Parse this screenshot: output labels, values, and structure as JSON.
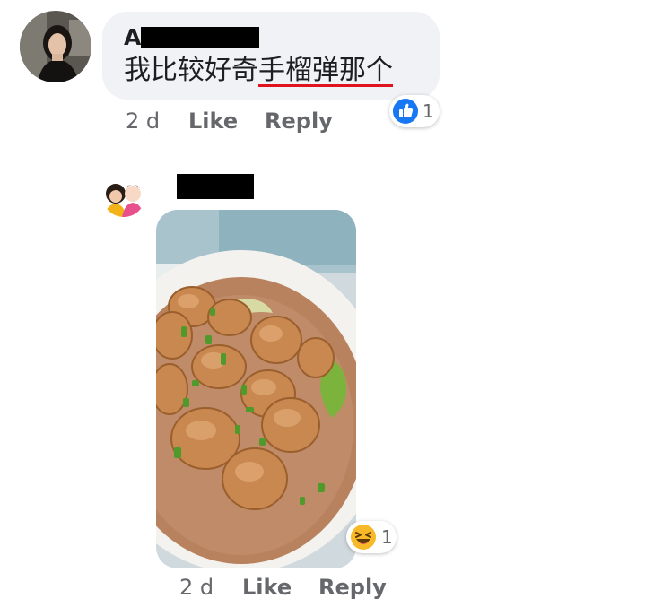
{
  "comment": {
    "author_initial": "A",
    "text_plain": "我比较好奇",
    "text_underlined": "手榴弹那个",
    "time": "2 d",
    "like_label": "Like",
    "reply_label": "Reply",
    "reaction": {
      "icon": "thumbs-up-icon",
      "color": "#1877f2",
      "count": "1"
    }
  },
  "reply": {
    "time": "2 d",
    "like_label": "Like",
    "reply_label": "Reply",
    "reaction": {
      "icon": "laughing-face-icon",
      "color": "#f7b928",
      "count": "1"
    }
  },
  "colors": {
    "bubble_bg": "#f0f2f5",
    "text": "#1c1e21",
    "meta_text": "#65676b",
    "spell_underline": "#e0141e"
  }
}
